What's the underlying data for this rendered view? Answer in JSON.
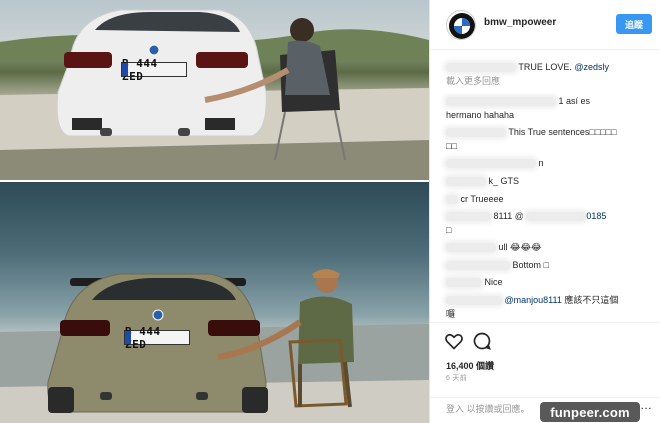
{
  "photo": {
    "plate_top": "B 444 ZED",
    "plate_bottom": "B 444 ZED",
    "alt": ""
  },
  "header": {
    "username": "bmw_mpoweer",
    "follow_label": "追蹤"
  },
  "comments": [
    {
      "text": "TRUE LOVE. ",
      "mention": "@zedsly"
    },
    {
      "text": "載入更多回應"
    },
    {
      "text": "1 así es"
    },
    {
      "text": "hermano hahaha"
    },
    {
      "text": "This True sentences□□□□□"
    },
    {
      "text": "□□"
    },
    {
      "text": "n"
    },
    {
      "text": "k_ GTS"
    },
    {
      "text": "cr Trueeee"
    },
    {
      "text": "8111 @ ",
      "mention_tail": "0185"
    },
    {
      "text": "□"
    },
    {
      "text": "ull 😂😂😂"
    },
    {
      "text": "Bottom □"
    },
    {
      "text": "Nice"
    },
    {
      "text": "",
      "mention": "@manjou8111",
      "tail": " 應該不只這個"
    },
    {
      "text": "囉"
    }
  ],
  "actions": {
    "like_icon": "heart-icon",
    "comment_icon": "comment-icon",
    "views": "16,400 個讚",
    "time": "6 天前",
    "login": "登入 以按讚或回應。",
    "more": "…"
  },
  "watermark": "funpeer.com"
}
